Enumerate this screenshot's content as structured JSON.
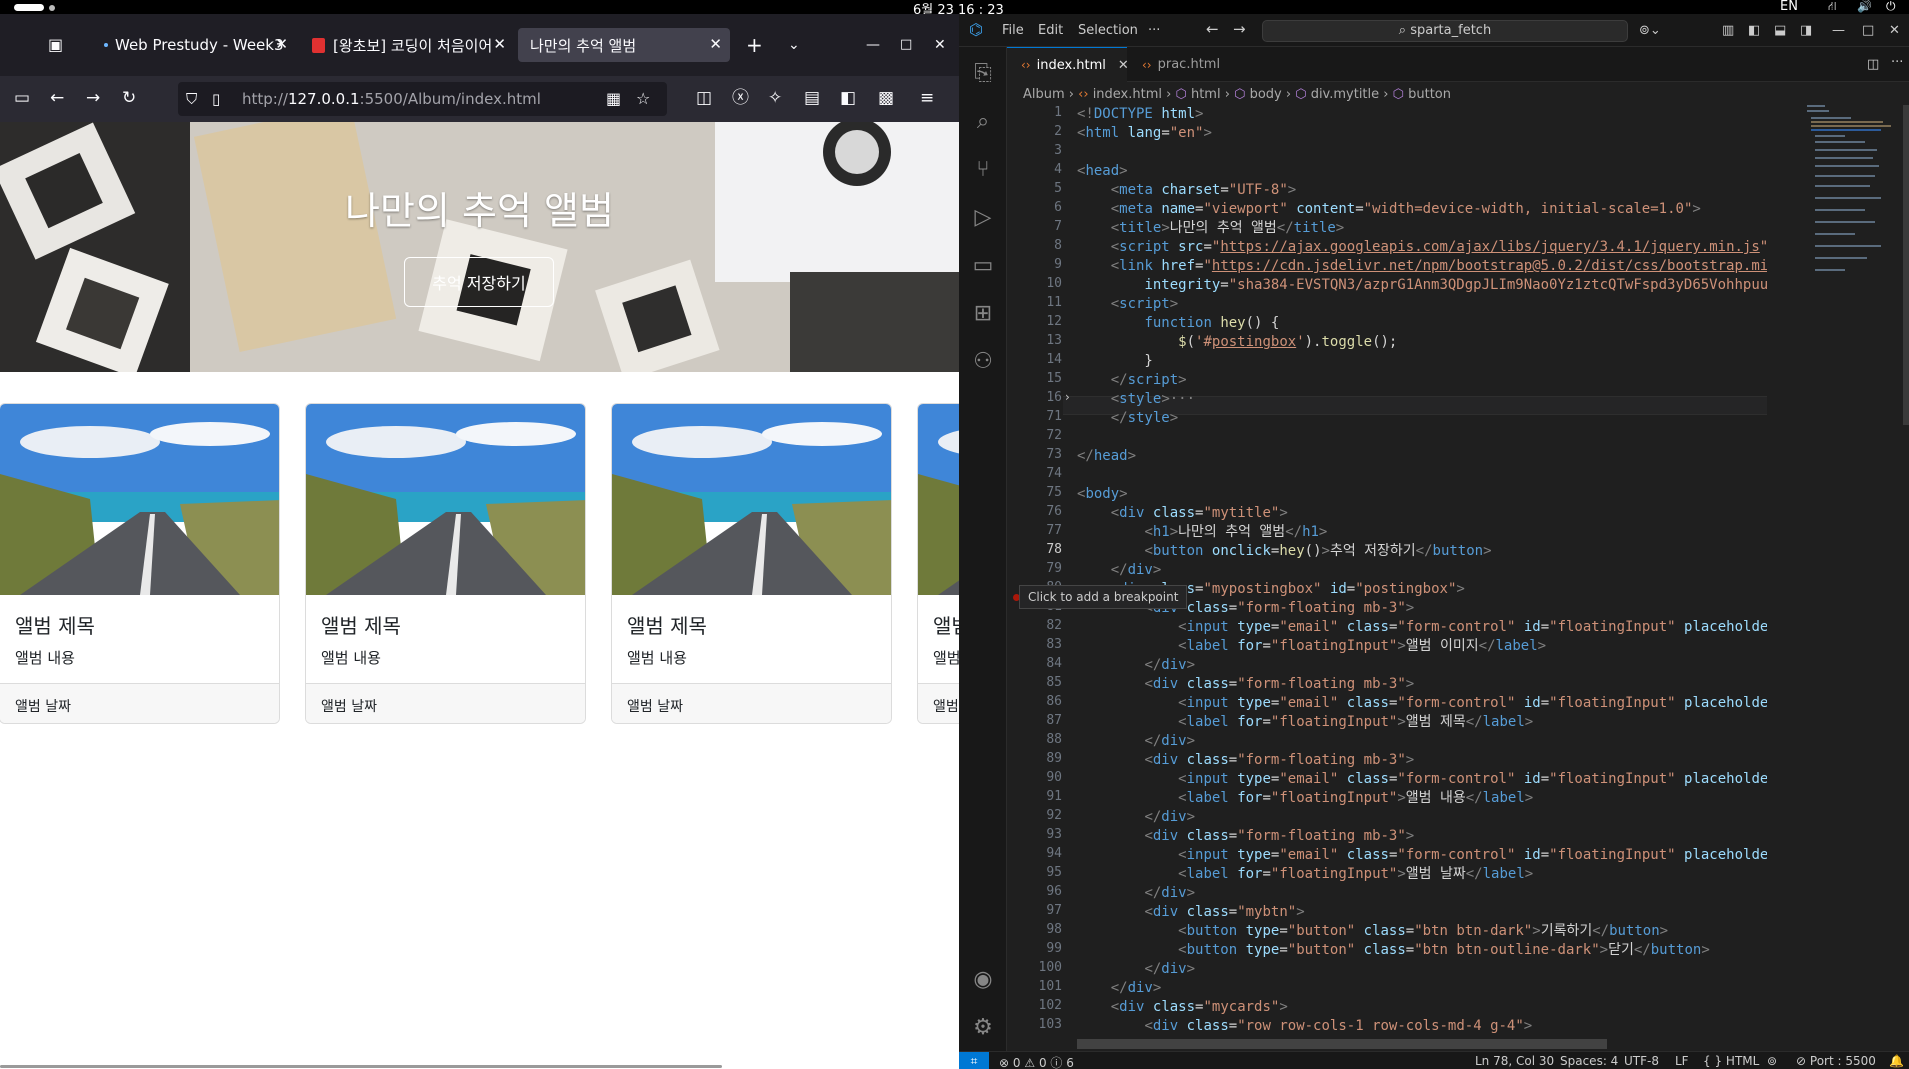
{
  "system": {
    "clock": "6월 23  16 : 23",
    "keyboard": "EN"
  },
  "firefox": {
    "tabs": [
      {
        "label": "Web Prestudy - Week3"
      },
      {
        "label": "[왕초보] 코딩이 처음이어도"
      },
      {
        "label": "나만의 추억 앨범"
      }
    ],
    "url_prefix": "http://",
    "url_host": "127.0.0.1",
    "url_rest": ":5500/Album/index.html"
  },
  "page": {
    "hero_title": "나만의 추억 앨범",
    "hero_button": "추억 저장하기",
    "cards": [
      {
        "title": "앨범 제목",
        "text": "앨범 내용",
        "date": "앨범 날짜"
      },
      {
        "title": "앨범 제목",
        "text": "앨범 내용",
        "date": "앨범 날짜"
      },
      {
        "title": "앨범 제목",
        "text": "앨범 내용",
        "date": "앨범 날짜"
      },
      {
        "title": "앨범 제목",
        "text": "앨범 내용",
        "date": "앨범 날짜"
      }
    ]
  },
  "vscode": {
    "menus": [
      "File",
      "Edit",
      "Selection",
      "···"
    ],
    "search": "sparta_fetch",
    "tabs": [
      {
        "label": "index.html"
      },
      {
        "label": "prac.html"
      }
    ],
    "breadcrumb": [
      "Album",
      "index.html",
      "html",
      "body",
      "div.mytitle",
      "button"
    ],
    "tooltip": "Click to add a breakpoint",
    "current_line": 78,
    "line_numbers": [
      1,
      2,
      3,
      4,
      5,
      6,
      7,
      8,
      9,
      10,
      11,
      12,
      13,
      14,
      15,
      16,
      71,
      72,
      73,
      74,
      75,
      76,
      77,
      78,
      79,
      80,
      81,
      82,
      83,
      84,
      85,
      86,
      87,
      88,
      89,
      90,
      91,
      92,
      93,
      94,
      95,
      96,
      97,
      98,
      99,
      100,
      101,
      102,
      103
    ],
    "status": {
      "errors": "0",
      "warnings": "0",
      "info": "6",
      "position": "Ln 78, Col 30",
      "spaces": "Spaces: 4",
      "encoding": "UTF-8",
      "eol": "LF",
      "language": "HTML",
      "port": "Port : 5500"
    }
  }
}
